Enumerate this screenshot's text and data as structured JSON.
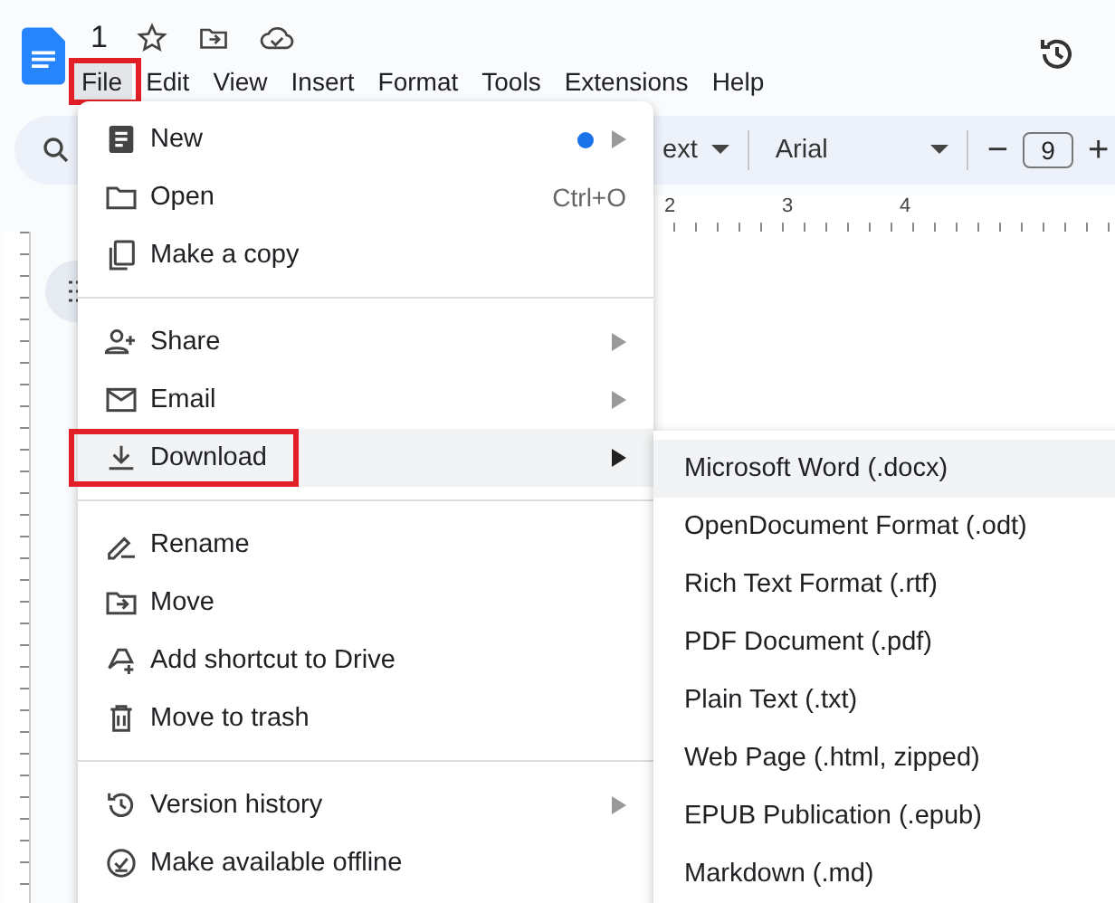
{
  "document": {
    "title": "1"
  },
  "menubar": [
    {
      "label": "File",
      "selected": true,
      "annotated": true
    },
    {
      "label": "Edit",
      "selected": false,
      "annotated": false
    },
    {
      "label": "View",
      "selected": false,
      "annotated": false
    },
    {
      "label": "Insert",
      "selected": false,
      "annotated": false
    },
    {
      "label": "Format",
      "selected": false,
      "annotated": false
    },
    {
      "label": "Tools",
      "selected": false,
      "annotated": false
    },
    {
      "label": "Extensions",
      "selected": false,
      "annotated": false
    },
    {
      "label": "Help",
      "selected": false,
      "annotated": false
    }
  ],
  "toolbar": {
    "style_dropdown": "ext",
    "font_dropdown": "Arial",
    "font_size": "9",
    "decrease": "−",
    "increase": "+"
  },
  "ruler": [
    "2",
    "3",
    "4"
  ],
  "file_menu": {
    "sections": [
      [
        {
          "label": "New",
          "notification_dot": true,
          "has_submenu": true,
          "selected": false,
          "annotated": false
        },
        {
          "label": "Open",
          "shortcut": "Ctrl+O",
          "has_submenu": false,
          "selected": false,
          "annotated": false
        },
        {
          "label": "Make a copy",
          "has_submenu": false,
          "selected": false,
          "annotated": false
        }
      ],
      [
        {
          "label": "Share",
          "has_submenu": true,
          "selected": false,
          "annotated": false
        },
        {
          "label": "Email",
          "has_submenu": true,
          "selected": false,
          "annotated": false
        },
        {
          "label": "Download",
          "has_submenu": true,
          "selected": true,
          "annotated": true
        }
      ],
      [
        {
          "label": "Rename",
          "has_submenu": false,
          "selected": false,
          "annotated": false
        },
        {
          "label": "Move",
          "has_submenu": false,
          "selected": false,
          "annotated": false
        },
        {
          "label": "Add shortcut to Drive",
          "has_submenu": false,
          "selected": false,
          "annotated": false
        },
        {
          "label": "Move to trash",
          "has_submenu": false,
          "selected": false,
          "annotated": false
        }
      ],
      [
        {
          "label": "Version history",
          "has_submenu": true,
          "selected": false,
          "annotated": false
        },
        {
          "label": "Make available offline",
          "has_submenu": false,
          "selected": false,
          "annotated": false
        }
      ]
    ]
  },
  "download_submenu": [
    {
      "label": "Microsoft Word (.docx)",
      "selected": true
    },
    {
      "label": "OpenDocument Format (.odt)",
      "selected": false
    },
    {
      "label": "Rich Text Format (.rtf)",
      "selected": false
    },
    {
      "label": "PDF Document (.pdf)",
      "selected": false
    },
    {
      "label": "Plain Text (.txt)",
      "selected": false
    },
    {
      "label": "Web Page (.html, zipped)",
      "selected": false
    },
    {
      "label": "EPUB Publication (.epub)",
      "selected": false
    },
    {
      "label": "Markdown (.md)",
      "selected": false
    }
  ]
}
